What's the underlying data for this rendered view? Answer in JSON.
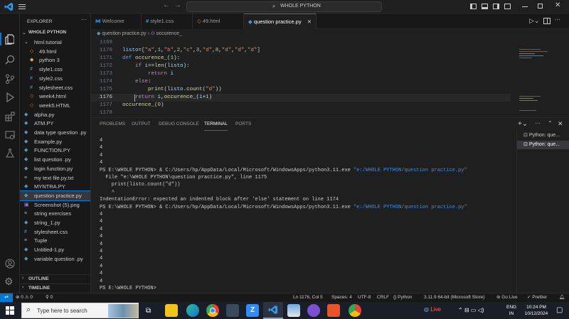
{
  "titlebar": {
    "search": "WHOLE PYTHON"
  },
  "explorer": {
    "header": "EXPLORER",
    "root": "WHOLE PYTHON",
    "items": [
      {
        "label": "html.tutorial",
        "icon": "folder-open-icon",
        "indent": 1,
        "color": "#ccc"
      },
      {
        "label": "49.html",
        "icon": "html-icon",
        "indent": 2,
        "color": "#e37933"
      },
      {
        "label": "python 3",
        "icon": "python-icon",
        "indent": 2,
        "color": "#e0b14e"
      },
      {
        "label": "style1.css",
        "icon": "css-icon",
        "indent": 2,
        "color": "#519aba"
      },
      {
        "label": "style2.css",
        "icon": "css-icon",
        "indent": 2,
        "color": "#519aba"
      },
      {
        "label": "stylesheet.css",
        "icon": "css-icon",
        "indent": 2,
        "color": "#519aba"
      },
      {
        "label": "week4.html",
        "icon": "html-icon",
        "indent": 2,
        "color": "#e37933"
      },
      {
        "label": "week5.HTML",
        "icon": "html-icon",
        "indent": 2,
        "color": "#e37933"
      },
      {
        "label": "alpha.py",
        "icon": "python-icon",
        "indent": 1,
        "color": "#519aba"
      },
      {
        "label": "ATM.PY",
        "icon": "python-icon",
        "indent": 1,
        "color": "#519aba"
      },
      {
        "label": "data type question .py",
        "icon": "python-icon",
        "indent": 1,
        "color": "#519aba"
      },
      {
        "label": "Example.py",
        "icon": "python-icon",
        "indent": 1,
        "color": "#519aba"
      },
      {
        "label": "FUNCTION.PY",
        "icon": "python-icon",
        "indent": 1,
        "color": "#519aba"
      },
      {
        "label": "list question .py",
        "icon": "python-icon",
        "indent": 1,
        "color": "#519aba"
      },
      {
        "label": "login function.py",
        "icon": "python-icon",
        "indent": 1,
        "color": "#519aba"
      },
      {
        "label": "my text file.py.txt",
        "icon": "text-icon",
        "indent": 1,
        "color": "#aaa"
      },
      {
        "label": "MYNTRA.PY",
        "icon": "python-icon",
        "indent": 1,
        "color": "#519aba"
      },
      {
        "label": "question practice.py",
        "icon": "python-icon",
        "indent": 1,
        "color": "#519aba",
        "selected": true
      },
      {
        "label": "Screenshot (5).png",
        "icon": "image-icon",
        "indent": 1,
        "color": "#a074c4"
      },
      {
        "label": "string exercises",
        "icon": "file-icon",
        "indent": 1,
        "color": "#aaa"
      },
      {
        "label": "string_1.py",
        "icon": "python-icon",
        "indent": 1,
        "color": "#519aba"
      },
      {
        "label": "stylesheet.css",
        "icon": "css-icon",
        "indent": 1,
        "color": "#519aba"
      },
      {
        "label": "Tuple",
        "icon": "file-icon",
        "indent": 1,
        "color": "#aaa"
      },
      {
        "label": "Untitled-1.py",
        "icon": "python-icon",
        "indent": 1,
        "color": "#519aba"
      },
      {
        "label": "variable question .py",
        "icon": "python-icon",
        "indent": 1,
        "color": "#519aba"
      }
    ],
    "outline": "OUTLINE",
    "timeline": "TIMELINE"
  },
  "tabs": [
    {
      "label": "Welcome",
      "icon": "vscode-icon"
    },
    {
      "label": "style1.css",
      "icon": "css-icon"
    },
    {
      "label": "49.html",
      "icon": "html-icon"
    },
    {
      "label": "question practice.py",
      "icon": "python-icon",
      "active": true
    }
  ],
  "breadcrumb": {
    "file": "question practice.py",
    "symbol": "occurence_"
  },
  "code": {
    "line_numbers": [
      "1169",
      "1170",
      "1171",
      "1172",
      "1173",
      "1174",
      "1175",
      "1176",
      "1177",
      "1178"
    ],
    "current_line": "1176"
  },
  "panel": {
    "tabs": [
      "PROBLEMS",
      "OUTPUT",
      "DEBUG CONSOLE",
      "TERMINAL",
      "PORTS"
    ],
    "active_tab": "TERMINAL",
    "terminal_instances": [
      "Python: que...",
      "Python: que..."
    ]
  },
  "terminal": {
    "lines": [
      {
        "t": "4"
      },
      {
        "t": "4"
      },
      {
        "t": "4"
      },
      {
        "t": "4"
      },
      {
        "prompt": "PS E:\\WHOLE PYTHON> ",
        "cmd": "& C:/Users/hp/AppData/Local/Microsoft/WindowsApps/python3.11.exe ",
        "arg": "\"e:/WHOLE PYTHON/question practice.py\""
      },
      {
        "t": "  File \"e:\\WHOLE PYTHON\\question practice.py\", line 1175"
      },
      {
        "t": "    print(listo.count(\"d\"))"
      },
      {
        "t": "    ^"
      },
      {
        "t": "IndentationError: expected an indented block after 'else' statement on line 1174"
      },
      {
        "prompt": "PS E:\\WHOLE PYTHON> ",
        "cmd": "& C:/Users/hp/AppData/Local/Microsoft/WindowsApps/python3.11.exe ",
        "arg": "\"e:/WHOLE PYTHON/question practice.py\""
      },
      {
        "t": "4"
      },
      {
        "t": "4"
      },
      {
        "t": "4"
      },
      {
        "t": "4"
      },
      {
        "t": "4"
      },
      {
        "t": "4"
      },
      {
        "t": "4"
      },
      {
        "t": "4"
      },
      {
        "t": "4"
      },
      {
        "t": "4"
      },
      {
        "t": "PS E:\\WHOLE PYTHON>"
      }
    ]
  },
  "status": {
    "errors": "0",
    "warnings": "0",
    "ports": "0",
    "position": "Ln 1176, Col 5",
    "spaces": "Spaces: 4",
    "encoding": "UTF-8",
    "eol": "CRLF",
    "language": "Python",
    "interpreter": "3.11.9 64-bit (Microsoft Store)",
    "golive": "Go Live",
    "prettier": "Prettier"
  },
  "taskbar": {
    "search_placeholder": "Type here to search",
    "weather": "Live",
    "lang_top": "ENG",
    "lang_bottom": "IN",
    "time": "10:24 PM",
    "date": "10/12/2024"
  },
  "colors": {
    "accent": "#0078d4",
    "remote": "#0078d4",
    "terminal_path": "#3b8eea"
  }
}
